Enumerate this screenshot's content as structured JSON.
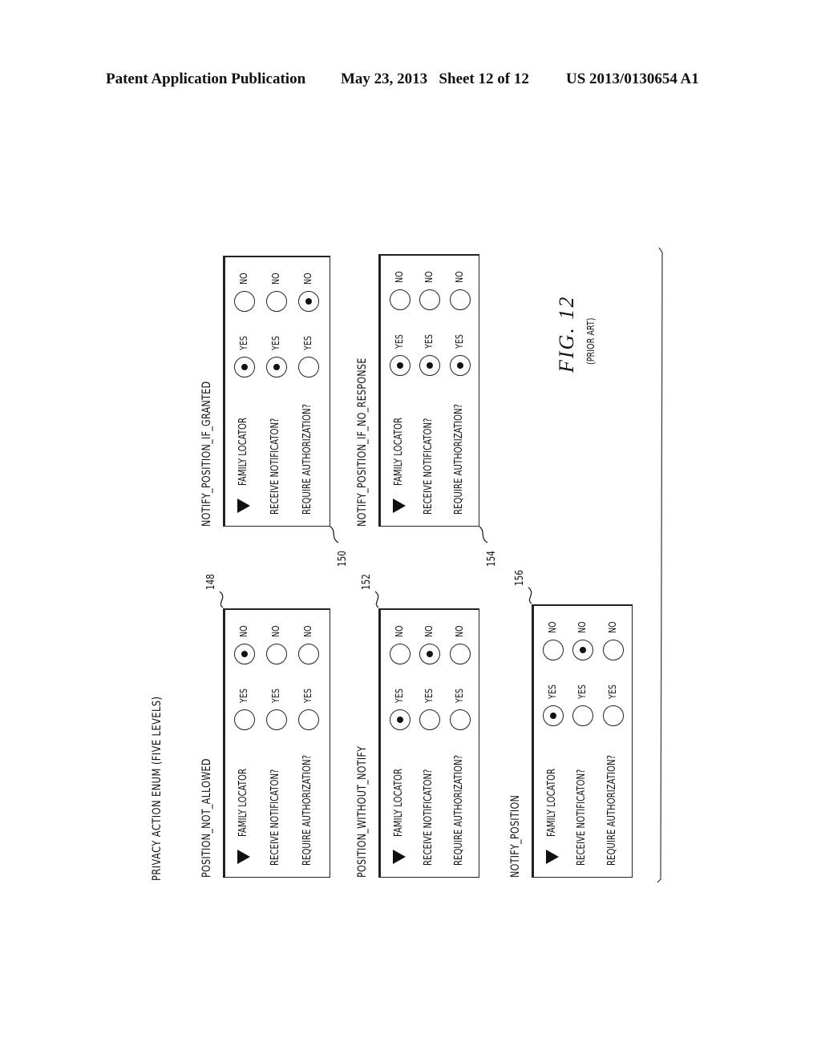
{
  "header": {
    "publication": "Patent Application Publication",
    "date_sheet": "May 23, 2013   Sheet 12 of 12",
    "patent_number": "US 2013/0130654 A1"
  },
  "figure": {
    "title": "PRIVACY ACTION ENUM (FIVE LEVELS)",
    "caption": "FIG. 12",
    "caption_note": "(PRIOR ART)",
    "option_labels": {
      "yes": "YES",
      "no": "NO"
    },
    "row_labels": [
      "FAMILY LOCATOR",
      "RECEIVE NOTIFICATON?",
      "REQUIRE AUTHORIZATION?"
    ],
    "levels": [
      {
        "name": "POSITION_NOT_ALLOWED",
        "ref": "148",
        "selections": {
          "family_locator": "NO",
          "receive_notification": "NONE",
          "require_authorization": "NONE"
        }
      },
      {
        "name": "NOTIFY_POSITION_IF_GRANTED",
        "ref": "150",
        "selections": {
          "family_locator": "YES",
          "receive_notification": "YES",
          "require_authorization": "NO"
        }
      },
      {
        "name": "POSITION_WITHOUT_NOTIFY",
        "ref": "152",
        "selections": {
          "family_locator": "YES",
          "receive_notification": "NO",
          "require_authorization": "NONE"
        }
      },
      {
        "name": "NOTIFY_POSITION_IF_NO_RESPONSE",
        "ref": "154",
        "selections": {
          "family_locator": "YES",
          "receive_notification": "YES",
          "require_authorization": "YES"
        }
      },
      {
        "name": "NOTIFY_POSITION",
        "ref": "156",
        "selections": {
          "family_locator": "YES",
          "receive_notification": "NO",
          "require_authorization": "NONE"
        }
      }
    ]
  }
}
